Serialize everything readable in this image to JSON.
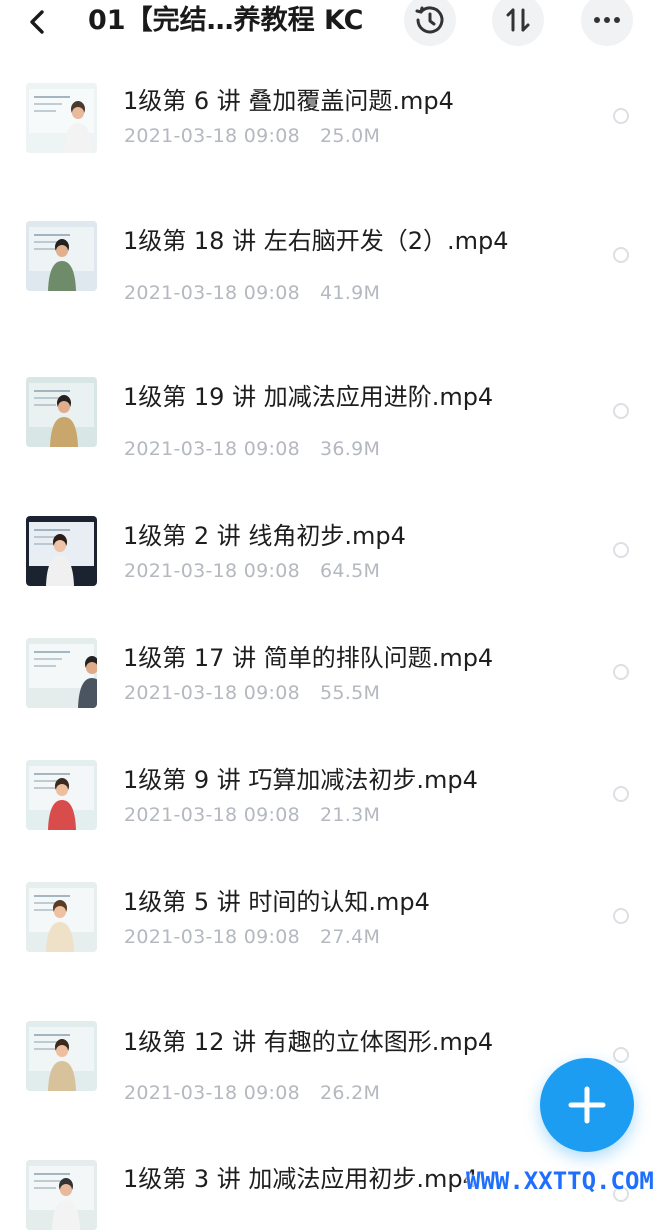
{
  "header": {
    "title": "01【完结…养教程 KC",
    "icons": [
      "back-icon",
      "history-icon",
      "sort-icon",
      "more-icon"
    ]
  },
  "files": [
    {
      "name": "1级第 6 讲 叠加覆盖问题.mp4",
      "date": "2021-03-18 09:08",
      "size": "25.0M"
    },
    {
      "name": "1级第 18 讲 左右脑开发（2）.mp4",
      "date": "2021-03-18 09:08",
      "size": "41.9M"
    },
    {
      "name": "1级第 19 讲 加减法应用进阶.mp4",
      "date": "2021-03-18 09:08",
      "size": "36.9M"
    },
    {
      "name": "1级第 2 讲 线角初步.mp4",
      "date": "2021-03-18 09:08",
      "size": "64.5M"
    },
    {
      "name": "1级第 17 讲 简单的排队问题.mp4",
      "date": "2021-03-18 09:08",
      "size": "55.5M"
    },
    {
      "name": "1级第 9 讲 巧算加减法初步.mp4",
      "date": "2021-03-18 09:08",
      "size": "21.3M"
    },
    {
      "name": "1级第 5 讲 时间的认知.mp4",
      "date": "2021-03-18 09:08",
      "size": "27.4M"
    },
    {
      "name": "1级第 12 讲 有趣的立体图形.mp4",
      "date": "2021-03-18 09:08",
      "size": "26.2M"
    },
    {
      "name": "1级第 3 讲 加减法应用初步.mp4",
      "date": "",
      "size": ""
    }
  ],
  "fab": {
    "icon": "plus-icon"
  },
  "watermark": "WWW.XXTTQ.COM",
  "colors": {
    "accent": "#1d9df2",
    "meta_text": "#b4b8bf",
    "icon_bg": "#f1f2f4"
  }
}
